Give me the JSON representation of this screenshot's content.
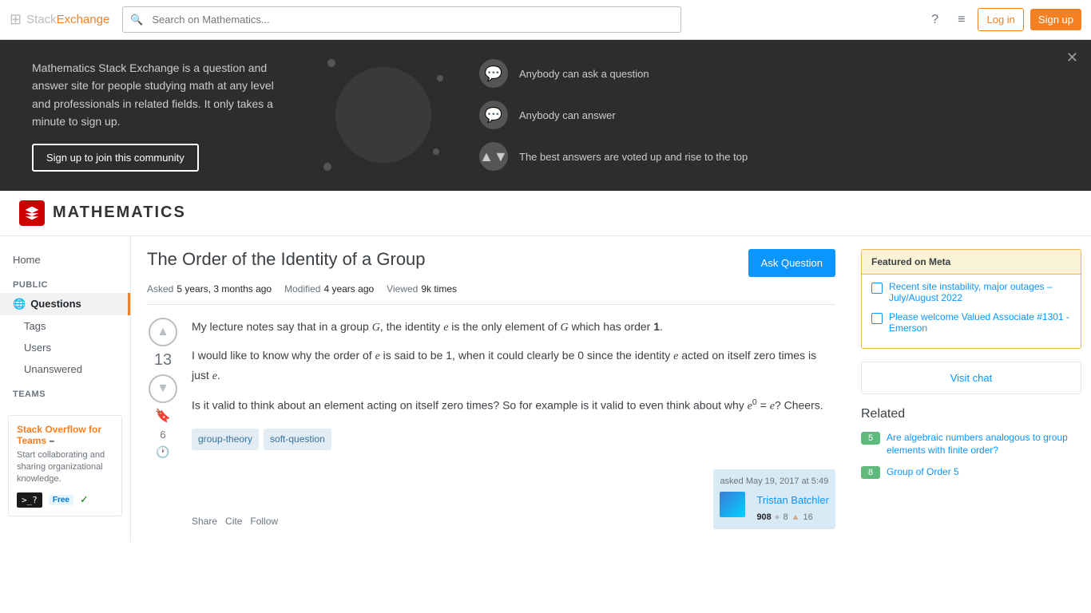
{
  "topbar": {
    "brand_prefix": "Stack",
    "brand_suffix": "Exchange",
    "search_placeholder": "Search on Mathematics...",
    "login_label": "Log in",
    "signup_label": "Sign up"
  },
  "hero": {
    "description": "Mathematics Stack Exchange is a question and answer site for people studying math at any level and professionals in related fields. It only takes a minute to sign up.",
    "join_label": "Sign up to join this community",
    "features": [
      {
        "text": "Anybody can ask a question"
      },
      {
        "text": "Anybody can answer"
      },
      {
        "text": "The best answers are voted up and rise to the top"
      }
    ]
  },
  "site": {
    "title": "MATHEMATICS"
  },
  "sidebar": {
    "nav": [
      {
        "label": "Home",
        "id": "home",
        "active": false,
        "sub": false
      },
      {
        "label": "Questions",
        "id": "questions",
        "active": true,
        "sub": false
      },
      {
        "label": "Tags",
        "id": "tags",
        "active": false,
        "sub": true
      },
      {
        "label": "Users",
        "id": "users",
        "active": false,
        "sub": true
      },
      {
        "label": "Unanswered",
        "id": "unanswered",
        "active": false,
        "sub": true
      }
    ],
    "public_label": "PUBLIC",
    "teams_label": "TEAMS",
    "teams_title": "Stack Overflow for Teams",
    "teams_link": "Stack Overflow for Teams",
    "teams_dash": " – ",
    "teams_cta": "Start collaborating and sharing organizational knowledge.",
    "teams_promo_code": ">_?",
    "free_label": "Free"
  },
  "question": {
    "title": "The Order of the Identity of a Group",
    "asked_label": "Asked",
    "asked_value": "5 years, 3 months ago",
    "modified_label": "Modified",
    "modified_value": "4 years ago",
    "viewed_label": "Viewed",
    "viewed_value": "9k times",
    "body_p1": "My lecture notes say that in a group G, the identity e is the only element of G which has order 1.",
    "body_p2": "I would like to know why the order of e is said to be 1, when it could clearly be 0 since the identity e acted on itself zero times is just e.",
    "body_p3": "Is it valid to think about an element acting on itself zero times? So for example is it valid to even think about why e⁰ = e? Cheers.",
    "vote_count": "13",
    "bookmark_count": "6",
    "tags": [
      "group-theory",
      "soft-question"
    ],
    "actions": {
      "share": "Share",
      "cite": "Cite",
      "follow": "Follow"
    },
    "asked_at": "asked May 19, 2017 at 5:49",
    "user": {
      "name": "Tristan Batchler",
      "rep": "908",
      "gold": "",
      "silver": "8",
      "bronze": "16"
    },
    "ask_button": "Ask Question"
  },
  "right_sidebar": {
    "featured_meta_title": "Featured on Meta",
    "featured_items": [
      {
        "text": "Recent site instability, major outages – July/August 2022"
      },
      {
        "text": "Please welcome Valued Associate #1301 - Emerson"
      }
    ],
    "visit_chat": "Visit chat",
    "related_title": "Related",
    "related_items": [
      {
        "score": "5",
        "answered": true,
        "text": "Are algebraic numbers analogous to group elements with finite order?"
      },
      {
        "score": "8",
        "answered": true,
        "text": "Group of Order 5"
      }
    ]
  }
}
